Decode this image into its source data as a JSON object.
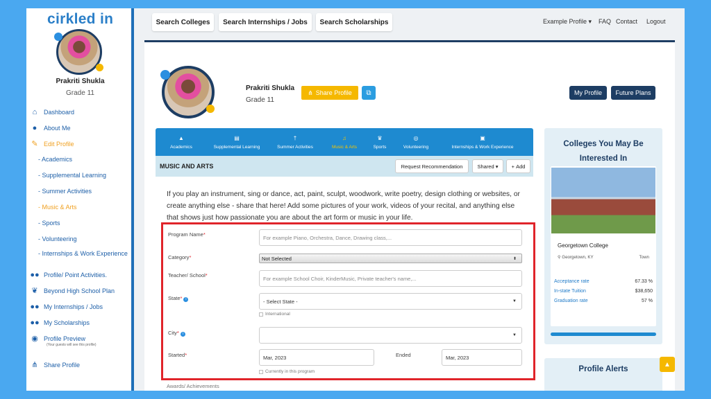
{
  "app": {
    "logo_main": "cirkled in",
    "logo_i": "i"
  },
  "sidebar": {
    "name": "Prakriti Shukla",
    "grade": "Grade 11",
    "items": [
      {
        "label": "Dashboard",
        "icon": "home-icon"
      },
      {
        "label": "About Me",
        "icon": "user-icon"
      },
      {
        "label": "Edit Profile",
        "icon": "edit-icon"
      }
    ],
    "sub_items": [
      "- Academics",
      "- Supplemental Learning",
      "- Summer Activities",
      "- Music & Arts",
      "- Sports",
      "- Volunteering"
    ],
    "sub_two": "- Internships & Work Experience",
    "items2": [
      {
        "label": "Profile/ Point Activities.",
        "icon": "users-icon"
      },
      {
        "label": "Beyond High School Plan",
        "icon": "leaf-icon"
      },
      {
        "label": "My Internships / Jobs",
        "icon": "users-icon"
      },
      {
        "label": "My Scholarships",
        "icon": "users-icon"
      },
      {
        "label": "Profile Preview",
        "icon": "eye-icon"
      }
    ],
    "preview_note": "(Your guests will see this profile)",
    "share": "Share Profile"
  },
  "topbar": {
    "search_colleges": "Search Colleges",
    "search_internships": "Search Internships / Jobs",
    "search_scholarships": "Search Scholarships",
    "example_profile": "Example Profile",
    "faq": "FAQ",
    "contact": "Contact",
    "logout": "Logout"
  },
  "profile": {
    "name": "Prakriti Shukla",
    "grade": "Grade 11",
    "share_btn": "Share Profile",
    "my_profile": "My Profile",
    "future_plans": "Future Plans"
  },
  "tabs": [
    {
      "label": "Academics",
      "icon": "grad-cap-icon"
    },
    {
      "label": "Supplemental Learning",
      "icon": "book-icon"
    },
    {
      "label": "Summer Activities",
      "icon": "person-icon"
    },
    {
      "label": "Music & Arts",
      "icon": "music-icon"
    },
    {
      "label": "Sports",
      "icon": "trophy-icon"
    },
    {
      "label": "Volunteering",
      "icon": "handshake-icon"
    },
    {
      "label": "Internships & Work Experience",
      "icon": "briefcase-icon"
    }
  ],
  "section": {
    "title": "MUSIC AND ARTS",
    "request": "Request Recommendation",
    "shared": "Shared",
    "add": "Add",
    "description": "If you play an instrument, sing or dance, act, paint, sculpt, woodwork, write poetry, design clothing or websites, or create anything else - share that here! Add some pictures of your work, videos of your recital, and anything else that shows just how passionate you are about the art form or music in your life."
  },
  "form": {
    "program_label": "Program Name",
    "program_placeholder": "For example Piano, Orchestra, Dance, Drawing class,...",
    "category_label": "Category",
    "category_value": "Not Selected",
    "teacher_label": "Teacher/ School",
    "teacher_placeholder": "For example School Choir, KinderMusic, Private teacher's name,...",
    "state_label": "State",
    "state_value": "- Select State -",
    "international": "International",
    "city_label": "City",
    "started_label": "Started",
    "started_value": "Mar, 2023",
    "ended_label": "Ended",
    "ended_value": "Mar, 2023",
    "current": "Currently in this program",
    "awards_label": "Awards/ Achievements"
  },
  "colleges": {
    "title": "Colleges You May Be Interested In",
    "name": "Georgetown College",
    "location": "Georgetown, KY",
    "type": "Town",
    "stats": [
      {
        "k": "Acceptance rate",
        "v": "67.33 %"
      },
      {
        "k": "In-state Tuition",
        "v": "$38,650"
      },
      {
        "k": "Graduation rate",
        "v": "57 %"
      }
    ]
  },
  "alerts": {
    "title": "Profile Alerts"
  }
}
